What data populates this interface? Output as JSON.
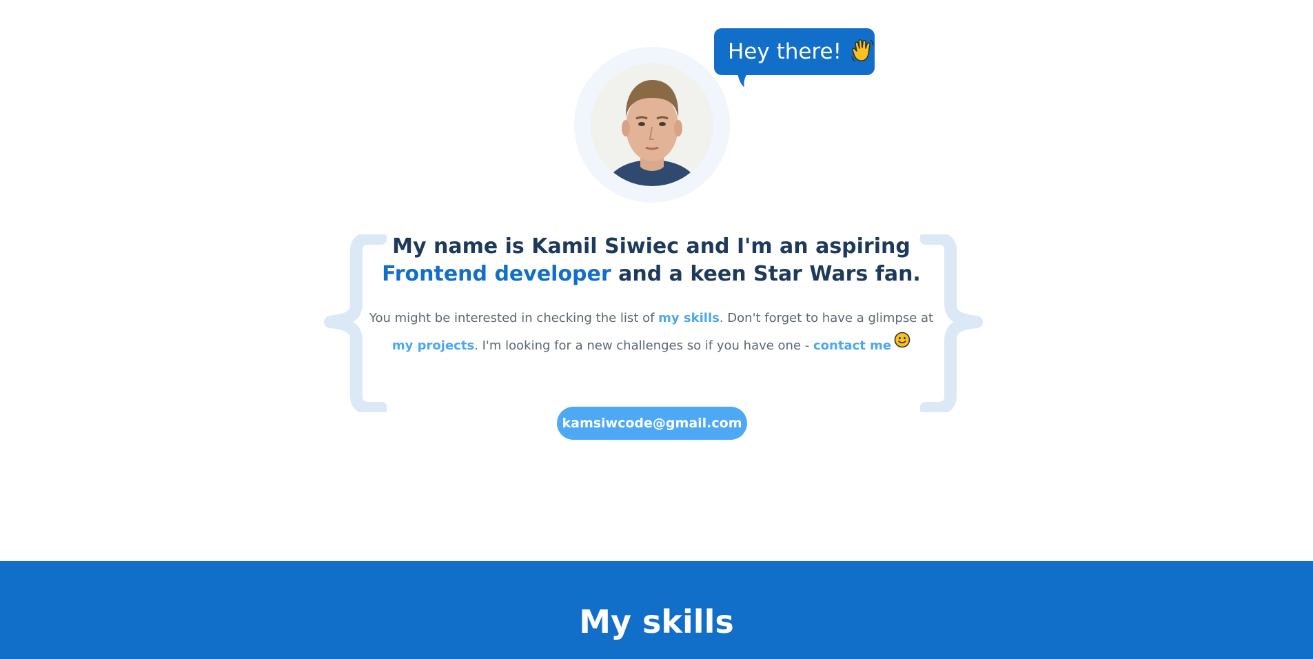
{
  "greeting": {
    "bubble_text": "Hey there!",
    "bubble_icon": "waving-hand-icon"
  },
  "avatar": {
    "icon": "profile-photo"
  },
  "intro": {
    "heading_part1": "My name is Kamil Siwiec and I'm an aspiring",
    "heading_accent": "Frontend developer",
    "heading_part2": "and a keen Star Wars fan.",
    "text_part1": "You might be interested in checking the list of ",
    "link_skills": "my skills",
    "text_part2": ". Don't forget to have a glimpse at ",
    "link_projects": "my projects",
    "text_part3": ". I'm looking for a new challenges so if you have one - ",
    "link_contact": "contact me",
    "smile_icon": "smiling-face-icon"
  },
  "contact": {
    "email_label": "kamsiwcode@gmail.com"
  },
  "skills": {
    "title": "My skills"
  },
  "colors": {
    "primary": "#126fc9",
    "accent_light": "#4da8f5",
    "heading": "#1d3a5c",
    "text": "#5b6675",
    "brace": "#dbe9f7"
  }
}
